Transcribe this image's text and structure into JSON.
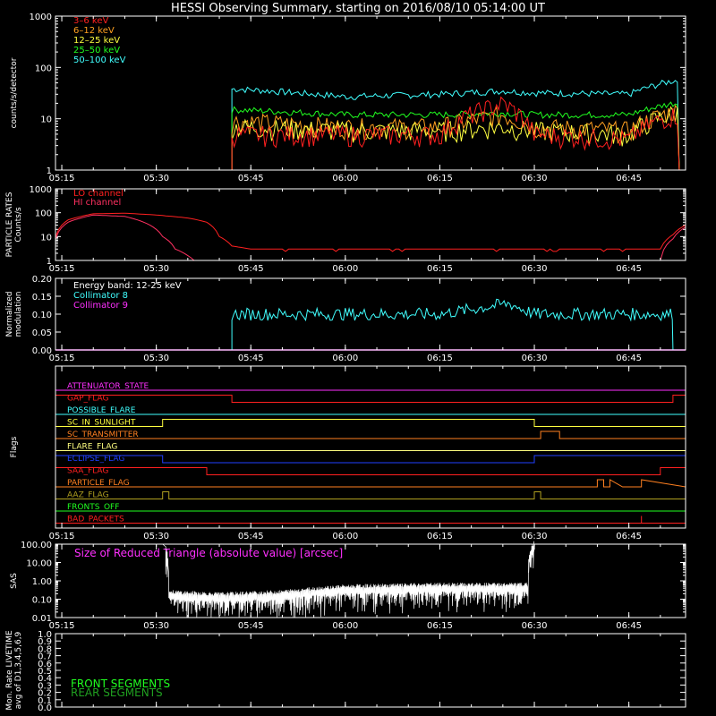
{
  "title": "HESSI Observing Summary, starting on 2016/08/10 05:14:00 UT",
  "time_ticks": [
    "05:15",
    "05:30",
    "05:45",
    "06:00",
    "06:15",
    "06:30",
    "06:45"
  ],
  "colors": {
    "bg": "#000000",
    "axis": "#ffffff"
  },
  "chart_data": [
    {
      "id": "count_rates",
      "type": "line",
      "ylabel": "counts/s/detector",
      "yscale": "log",
      "ylim": [
        1,
        1000
      ],
      "yticks": [
        "1",
        "10",
        "100",
        "1000"
      ],
      "xlim": [
        "05:14",
        "06:54"
      ],
      "legend_placement": "top-left",
      "series": [
        {
          "name": "3–6 keV",
          "color": "#ff2020",
          "data_start": "05:42",
          "data_end": "06:53",
          "level": 5.0,
          "x": [
            "05:43",
            "06:00",
            "06:15",
            "06:25",
            "06:30",
            "06:45",
            "06:52"
          ],
          "y": [
            5,
            5,
            5,
            20,
            5,
            4,
            12
          ]
        },
        {
          "name": "6–12 keV",
          "color": "#ffa020",
          "data_start": "05:42",
          "data_end": "06:53",
          "level": 8.0,
          "x": [
            "05:43",
            "06:00",
            "06:15",
            "06:25",
            "06:30",
            "06:45",
            "06:52"
          ],
          "y": [
            9,
            7,
            7,
            12,
            7,
            6,
            14
          ]
        },
        {
          "name": "12–25 keV",
          "color": "#ffff40",
          "data_start": "05:42",
          "data_end": "06:53",
          "level": 6.5,
          "x": [
            "05:43",
            "06:00",
            "06:15",
            "06:25",
            "06:30",
            "06:45",
            "06:52"
          ],
          "y": [
            7,
            6,
            6,
            7,
            6,
            5,
            13
          ]
        },
        {
          "name": "25–50 keV",
          "color": "#20ff20",
          "data_start": "05:42",
          "data_end": "06:53",
          "level": 13.0,
          "x": [
            "05:43",
            "06:00",
            "06:15",
            "06:25",
            "06:30",
            "06:45",
            "06:52"
          ],
          "y": [
            15,
            12,
            12,
            13,
            12,
            12,
            20
          ]
        },
        {
          "name": "50–100 keV",
          "color": "#40ffff",
          "data_start": "05:42",
          "data_end": "06:53",
          "level": 30.0,
          "x": [
            "05:43",
            "06:00",
            "06:15",
            "06:25",
            "06:30",
            "06:45",
            "06:52"
          ],
          "y": [
            38,
            27,
            30,
            35,
            32,
            30,
            55
          ]
        }
      ]
    },
    {
      "id": "particle_rates",
      "type": "line",
      "ylabel": "PARTICLE RATES Counts/s",
      "ylabel_lines": [
        "PARTICLE RATES",
        "Counts/s"
      ],
      "yscale": "log",
      "ylim": [
        1,
        1000
      ],
      "yticks": [
        "1",
        "10",
        "100",
        "1000"
      ],
      "series": [
        {
          "name": "LO channel",
          "color": "#ff2020",
          "x": [
            "05:14",
            "05:16",
            "05:20",
            "05:25",
            "05:30",
            "05:35",
            "05:38",
            "05:40",
            "05:42",
            "05:45",
            "06:00",
            "06:30",
            "06:50",
            "06:52",
            "06:54"
          ],
          "y": [
            10,
            50,
            90,
            95,
            80,
            60,
            40,
            10,
            4,
            3,
            3,
            3,
            3,
            12,
            30
          ]
        },
        {
          "name": "HI channel",
          "color": "#ff3060",
          "x": [
            "05:14",
            "05:16",
            "05:20",
            "05:25",
            "05:28",
            "05:31",
            "05:33",
            "05:35",
            "05:36",
            "06:50",
            "06:52",
            "06:54"
          ],
          "y": [
            8,
            40,
            80,
            70,
            40,
            10,
            3,
            1.6,
            1,
            1,
            8,
            25
          ]
        }
      ]
    },
    {
      "id": "modulation",
      "type": "line",
      "ylabel": "Normalized modulation",
      "ylabel_lines": [
        "Normalized",
        "modulation"
      ],
      "ylim": [
        0,
        0.2
      ],
      "yticks": [
        "0.00",
        "0.05",
        "0.10",
        "0.15",
        "0.20"
      ],
      "annotation": "Energy band: 12-25 keV",
      "series": [
        {
          "name": "Collimator 8",
          "color": "#40ffff",
          "data_start": "05:42",
          "data_end": "06:52",
          "level": 0.1,
          "x": [
            "05:42",
            "06:00",
            "06:15",
            "06:26",
            "06:30",
            "06:52"
          ],
          "y": [
            0.1,
            0.1,
            0.1,
            0.13,
            0.1,
            0.1
          ]
        },
        {
          "name": "Collimator 9",
          "color": "#ff30ff",
          "x": [
            "05:14",
            "06:54"
          ],
          "y": [
            0,
            0
          ]
        }
      ]
    },
    {
      "id": "flags",
      "type": "line",
      "ylabel": "Flags",
      "series": [
        {
          "name": "ATTENUATOR_STATE",
          "color": "#ff30ff",
          "x": [
            "05:14",
            "06:54"
          ],
          "y": [
            0,
            0
          ]
        },
        {
          "name": "GAP_FLAG",
          "color": "#ff2020",
          "x": [
            "05:14",
            "05:42",
            "05:42",
            "06:52",
            "06:52",
            "06:54"
          ],
          "y": [
            1,
            1,
            0,
            0,
            1,
            1
          ]
        },
        {
          "name": "POSSIBLE_FLARE",
          "color": "#40ffff",
          "x": [
            "05:14",
            "06:54"
          ],
          "y": [
            0,
            0
          ]
        },
        {
          "name": "SC_IN_SUNLIGHT",
          "color": "#ffff40",
          "x": [
            "05:14",
            "05:31",
            "05:31",
            "06:30",
            "06:30",
            "06:54"
          ],
          "y": [
            0,
            0,
            1,
            1,
            0,
            0
          ]
        },
        {
          "name": "SC_TRANSMITTER",
          "color": "#ff8020",
          "x": [
            "05:14",
            "06:31",
            "06:31",
            "06:34",
            "06:34",
            "06:54"
          ],
          "y": [
            0,
            0,
            1,
            1,
            0,
            0
          ]
        },
        {
          "name": "FLARE_FLAG",
          "color": "#ffff80",
          "x": [
            "05:14",
            "06:54"
          ],
          "y": [
            0,
            0
          ]
        },
        {
          "name": "ECLIPSE_FLAG",
          "color": "#2040ff",
          "x": [
            "05:14",
            "05:31",
            "05:31",
            "06:30",
            "06:30",
            "06:54"
          ],
          "y": [
            1,
            1,
            0,
            0,
            1,
            1
          ]
        },
        {
          "name": "SAA_FLAG",
          "color": "#ff2020",
          "x": [
            "05:14",
            "05:38",
            "05:38",
            "06:50",
            "06:50",
            "06:54"
          ],
          "y": [
            1,
            1,
            0,
            0,
            1,
            1
          ]
        },
        {
          "name": "PARTICLE_FLAG",
          "color": "#ff8020",
          "x": [
            "05:14",
            "06:40",
            "06:40",
            "06:41",
            "06:41",
            "06:42",
            "06:42",
            "06:44",
            "06:44",
            "06:47",
            "06:47",
            "06:54"
          ],
          "y": [
            0,
            0,
            1,
            1,
            0,
            0,
            1,
            0,
            0,
            0,
            1,
            0
          ]
        },
        {
          "name": "AAZ_FLAG",
          "color": "#b0a020",
          "x": [
            "05:14",
            "05:31",
            "05:31",
            "05:32",
            "05:32",
            "06:30",
            "06:30",
            "06:31",
            "06:31",
            "06:54"
          ],
          "y": [
            0,
            0,
            1,
            1,
            0,
            0,
            1,
            1,
            0,
            0
          ]
        },
        {
          "name": "FRONTS_OFF",
          "color": "#20ff20",
          "x": [
            "05:14",
            "06:54"
          ],
          "y": [
            0,
            0
          ]
        },
        {
          "name": "BAD_PACKETS",
          "color": "#ff2020",
          "x": [
            "05:14",
            "06:47",
            "06:47",
            "06:47",
            "06:54"
          ],
          "y": [
            0,
            0,
            1,
            0,
            0
          ]
        }
      ]
    },
    {
      "id": "sas",
      "type": "line",
      "ylabel": "SAS",
      "yscale": "log",
      "ylim": [
        0.01,
        100
      ],
      "yticks": [
        "0.01",
        "0.10",
        "1.00",
        "10.00",
        "100.00"
      ],
      "annotation": "Size of Reduced Triangle (absolute value) [arcsec]",
      "series": [
        {
          "name": "Size of Reduced Triangle",
          "color": "#ffffff",
          "data_start": "05:31",
          "data_end": "06:30",
          "x": [
            "05:31",
            "05:32",
            "05:40",
            "05:50",
            "06:00",
            "06:15",
            "06:29",
            "06:30"
          ],
          "y": [
            100,
            0.2,
            0.15,
            0.2,
            0.4,
            0.5,
            0.5,
            100
          ]
        }
      ]
    },
    {
      "id": "livetime",
      "type": "line",
      "ylabel": "Mon. Rate LIVETIME avg of D1,3,4,5,6,9",
      "ylabel_lines": [
        "Mon. Rate LIVETIME",
        "avg of D1,3,4,5,6,9"
      ],
      "ylim": [
        0,
        1.0
      ],
      "yticks": [
        "0.0",
        "0.1",
        "0.2",
        "0.3",
        "0.4",
        "0.5",
        "0.6",
        "0.7",
        "0.8",
        "0.9",
        "1.0"
      ],
      "series": [
        {
          "name": "FRONT SEGMENTS",
          "color": "#20ff20",
          "x": [],
          "y": []
        },
        {
          "name": "REAR SEGMENTS",
          "color": "#20a020",
          "x": [],
          "y": []
        }
      ]
    }
  ]
}
